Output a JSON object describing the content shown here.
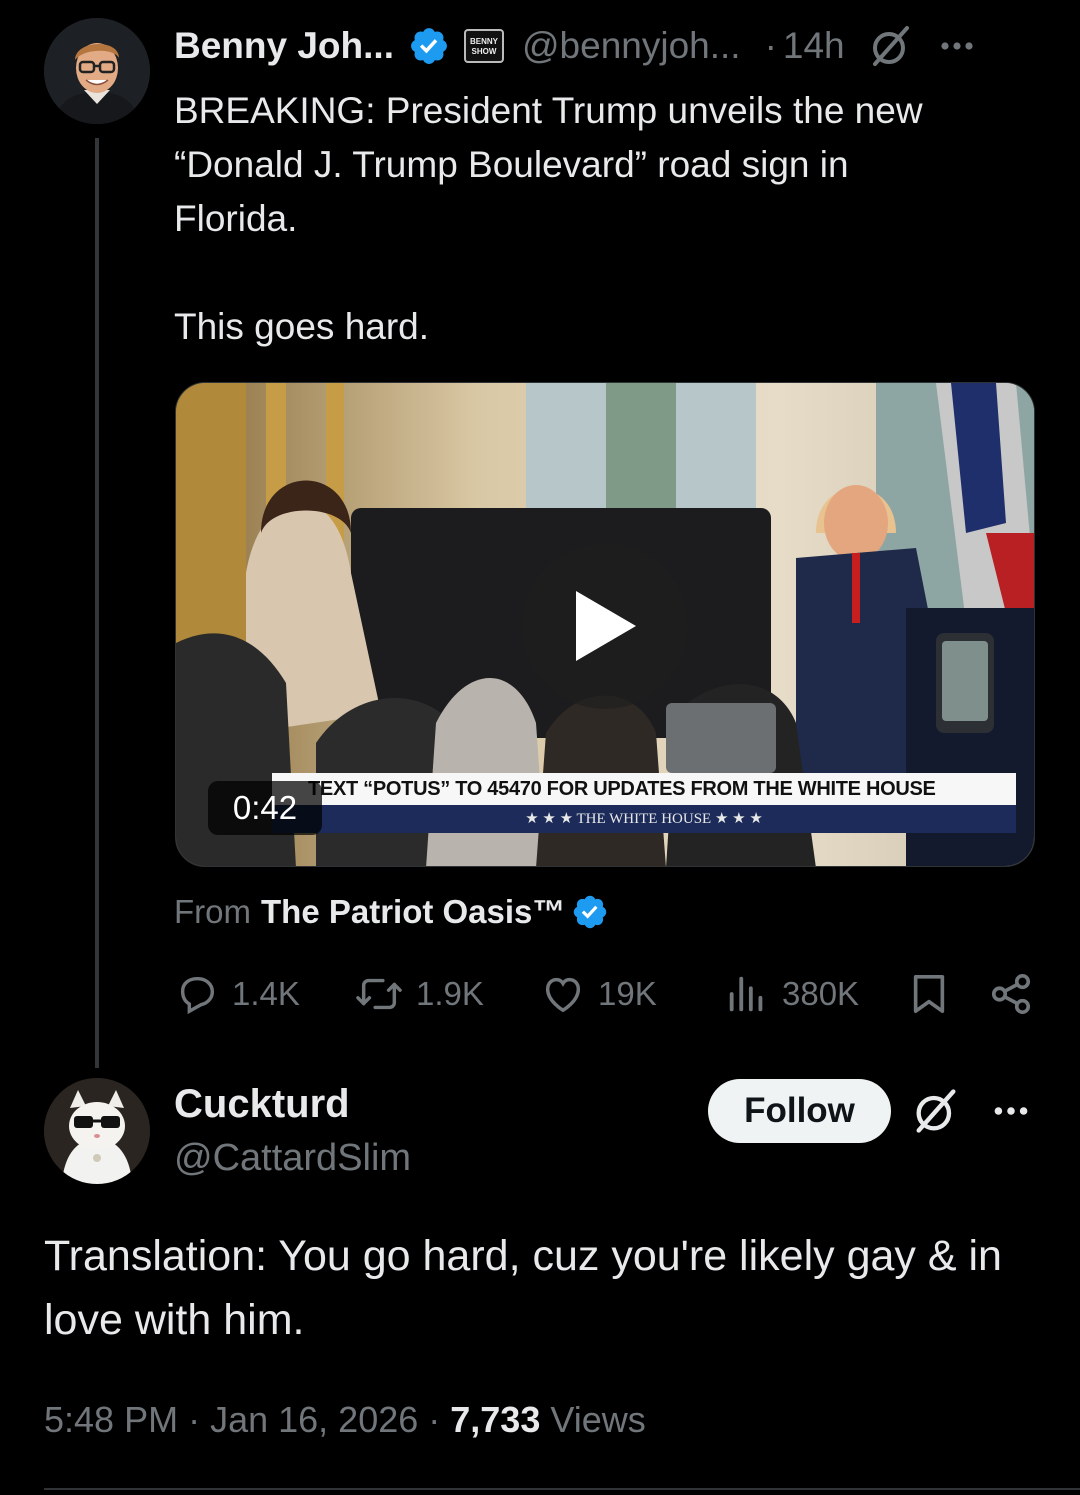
{
  "colors": {
    "background": "#000000",
    "primary_text": "#e7e9ea",
    "secondary_text": "#71767b",
    "verified_blue": "#1d9bf0",
    "divider": "#2f3336"
  },
  "parent_tweet": {
    "author": {
      "display_name": "Benny Joh...",
      "handle": "@bennyjoh...",
      "verified_icon": "verified-badge-icon",
      "affiliate_badge_text": "BENNY SHOW"
    },
    "age": "14h",
    "dot": "·",
    "text_lines": [
      "BREAKING: President Trump unveils the new",
      "“Donald J. Trump Boulevard” road sign in",
      "Florida.",
      "",
      "This goes hard."
    ],
    "media": {
      "duration": "0:42",
      "chyron_top": "TEXT “POTUS” TO 45470 FOR UPDATES FROM THE WHITE HOUSE",
      "chyron_bottom": "★ ★ ★   THE WHITE HOUSE   ★ ★ ★",
      "play_icon": "play-icon"
    },
    "source": {
      "label": "From",
      "name": "The Patriot Oasis™"
    },
    "actions": {
      "replies": "1.4K",
      "reposts": "1.9K",
      "likes": "19K",
      "views": "380K"
    }
  },
  "reply_tweet": {
    "author": {
      "display_name": "Cuckturd",
      "handle": "@CattardSlim"
    },
    "follow_label": "Follow",
    "text": "Translation: You go hard, cuz you're likely gay & in love with him.",
    "timestamp": "5:48 PM",
    "date": "Jan 16, 2026",
    "separator": "·",
    "views_count": "7,733",
    "views_label": "Views"
  }
}
